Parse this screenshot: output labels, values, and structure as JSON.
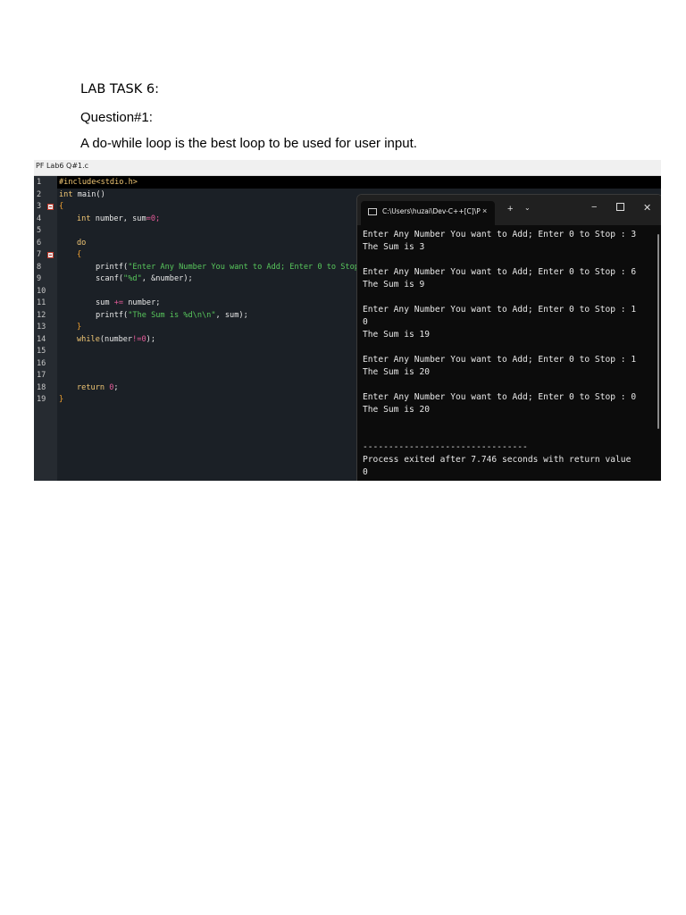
{
  "doc": {
    "heading": "LAB TASK 6:",
    "question": "Question#1:",
    "answer": "A do-while loop is the best loop to be used for user input."
  },
  "editor": {
    "tab_label": "PF Lab6 Q#1.c",
    "line_numbers": [
      "1",
      "2",
      "3",
      "4",
      "5",
      "6",
      "7",
      "8",
      "9",
      "10",
      "11",
      "12",
      "13",
      "14",
      "15",
      "16",
      "17",
      "18",
      "19"
    ],
    "code": {
      "l1": "#include<stdio.h>",
      "l2_kw": "int",
      "l2_rest": " main()",
      "l3": "{",
      "l4_kw": "int",
      "l4_a": " number, sum",
      "l4_op": "=",
      "l4_num": "0",
      "l4_end": ";",
      "l6": "do",
      "l7": "{",
      "l8_fn": "printf(",
      "l8_str": "\"Enter Any Number You want to Add; Enter 0 to Stop",
      "l9_fn": "scanf(",
      "l9_str": "\"%d\"",
      "l9_end": ", &number);",
      "l11_a": "sum ",
      "l11_op": "+=",
      "l11_b": " number;",
      "l12_fn": "printf(",
      "l12_str": "\"The Sum is %d\\n\\n\"",
      "l12_end": ", sum);",
      "l13": "}",
      "l14_kw": "while",
      "l14_a": "(number",
      "l14_op": "!=",
      "l14_num": "0",
      "l14_end": ");",
      "l18_kw": "return",
      "l18_num": "0",
      "l18_end": ";",
      "l19": "}"
    }
  },
  "terminal": {
    "title": "C:\\Users\\huzai\\Dev-C++[C]\\P",
    "close_glyph": "×",
    "new_tab_glyph": "+",
    "dropdown_glyph": "⌄",
    "minimize_glyph": "−",
    "window_close_glyph": "✕",
    "output": "Enter Any Number You want to Add; Enter 0 to Stop : 3\nThe Sum is 3\n\nEnter Any Number You want to Add; Enter 0 to Stop : 6\nThe Sum is 9\n\nEnter Any Number You want to Add; Enter 0 to Stop : 1\n0\nThe Sum is 19\n\nEnter Any Number You want to Add; Enter 0 to Stop : 1\nThe Sum is 20\n\nEnter Any Number You want to Add; Enter 0 to Stop : 0\nThe Sum is 20\n\n\n--------------------------------\nProcess exited after 7.746 seconds with return value\n0"
  }
}
